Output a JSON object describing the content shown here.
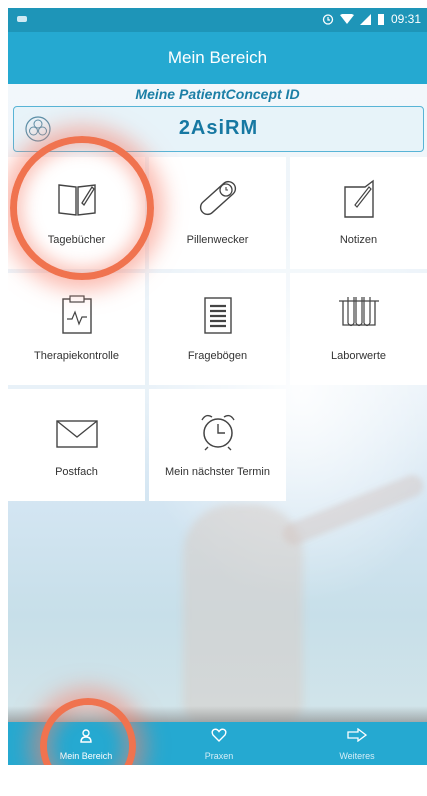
{
  "status": {
    "time": "09:31"
  },
  "appbar": {
    "title": "Mein Bereich"
  },
  "patient": {
    "label": "Meine PatientConcept ID",
    "id": "2AsiRM"
  },
  "tiles": [
    {
      "label": "Tagebücher",
      "icon": "book-pen-icon"
    },
    {
      "label": "Pillenwecker",
      "icon": "pill-clock-icon"
    },
    {
      "label": "Notizen",
      "icon": "notepad-pen-icon"
    },
    {
      "label": "Therapiekontrolle",
      "icon": "clipboard-chart-icon"
    },
    {
      "label": "Fragebögen",
      "icon": "checklist-icon"
    },
    {
      "label": "Laborwerte",
      "icon": "test-tubes-icon"
    },
    {
      "label": "Postfach",
      "icon": "envelope-icon"
    },
    {
      "label": "Mein nächster Termin",
      "icon": "alarm-clock-icon"
    }
  ],
  "nav": [
    {
      "label": "Mein Bereich",
      "icon": "person-icon",
      "active": true
    },
    {
      "label": "Praxen",
      "icon": "heart-icon",
      "active": false
    },
    {
      "label": "Weiteres",
      "icon": "arrow-right-icon",
      "active": false
    }
  ],
  "colors": {
    "primary": "#25a9d1",
    "statusbar": "#1e95b8",
    "highlight": "#f0734f",
    "idText": "#1778a2"
  }
}
